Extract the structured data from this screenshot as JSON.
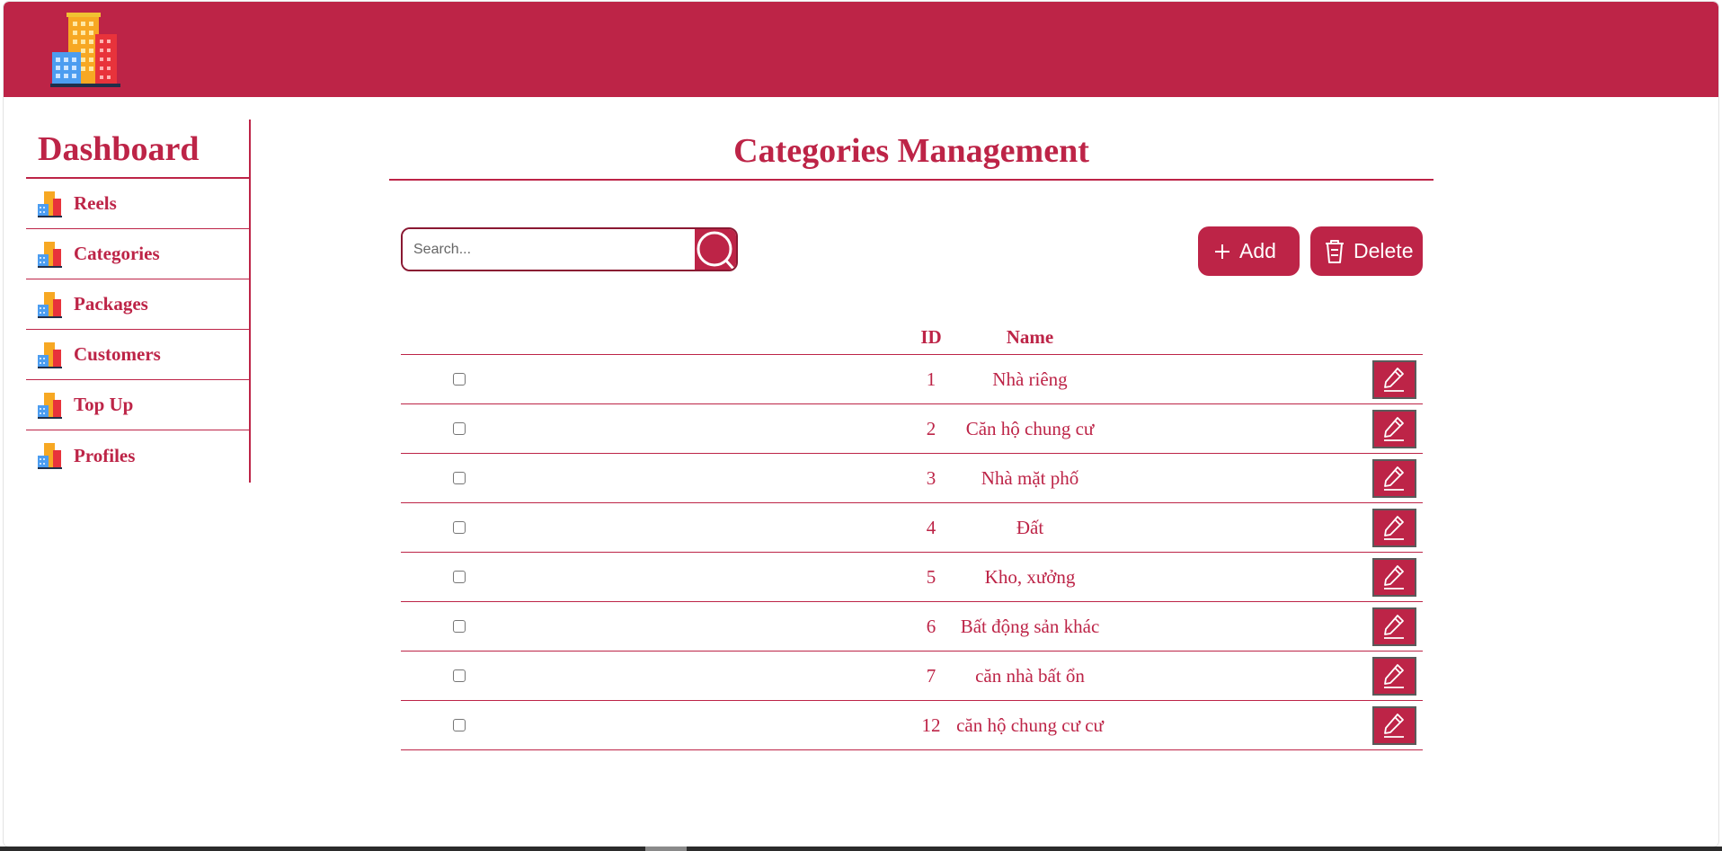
{
  "header": {
    "logo_icon": "buildings-logo-icon",
    "brand_color": "#bd2447"
  },
  "sidebar": {
    "title": "Dashboard",
    "items": [
      {
        "label": "Reels",
        "icon": "buildings-icon"
      },
      {
        "label": "Categories",
        "icon": "buildings-icon"
      },
      {
        "label": "Packages",
        "icon": "buildings-icon"
      },
      {
        "label": "Customers",
        "icon": "buildings-icon"
      },
      {
        "label": "Top Up",
        "icon": "buildings-icon"
      },
      {
        "label": "Profiles",
        "icon": "buildings-icon"
      }
    ]
  },
  "main": {
    "title": "Categories Management",
    "search": {
      "placeholder": "Search...",
      "value": ""
    },
    "add_label": "Add",
    "delete_label": "Delete",
    "table": {
      "columns": [
        "ID",
        "Name"
      ],
      "rows": [
        {
          "id": "1",
          "name": "Nhà riêng"
        },
        {
          "id": "2",
          "name": "Căn hộ chung cư"
        },
        {
          "id": "3",
          "name": "Nhà mặt phố"
        },
        {
          "id": "4",
          "name": "Đất"
        },
        {
          "id": "5",
          "name": "Kho, xưởng"
        },
        {
          "id": "6",
          "name": "Bất động sản khác"
        },
        {
          "id": "7",
          "name": "căn nhà bất ổn"
        },
        {
          "id": "12",
          "name": "căn hộ chung cư cư"
        }
      ]
    }
  }
}
